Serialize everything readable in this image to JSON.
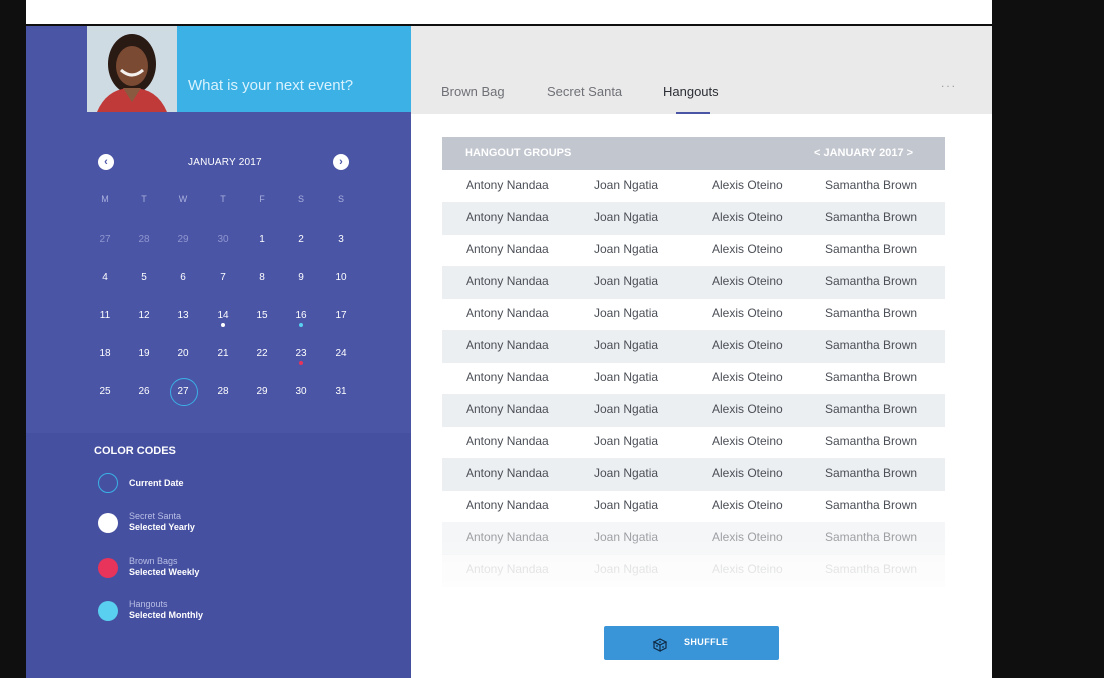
{
  "sidebar": {
    "prompt": "What is your next event?",
    "calendar": {
      "month": "JANUARY 2017",
      "prev_icon": "chevron-left-circle-icon",
      "next_icon": "chevron-right-circle-icon",
      "weekdays": [
        "M",
        "T",
        "W",
        "T",
        "F",
        "S",
        "S"
      ],
      "weeks": [
        [
          "27",
          "28",
          "29",
          "30",
          "1",
          "2",
          "3"
        ],
        [
          "4",
          "5",
          "6",
          "7",
          "8",
          "9",
          "10"
        ],
        [
          "11",
          "12",
          "13",
          "14",
          "15",
          "16",
          "17"
        ],
        [
          "18",
          "19",
          "20",
          "21",
          "22",
          "23",
          "24"
        ],
        [
          "25",
          "26",
          "27",
          "28",
          "29",
          "30",
          "31"
        ]
      ],
      "selected_day": "27"
    },
    "color_codes": {
      "title": "COLOR CODES",
      "items": [
        {
          "small": "",
          "strong": "Current Date",
          "color": "#3bb1e6",
          "style": "ring"
        },
        {
          "small": "Secret Santa",
          "strong": "Selected Yearly",
          "color": "#ffffff",
          "style": "fill"
        },
        {
          "small": "Brown Bags",
          "strong": "Selected Weekly",
          "color": "#e8335a",
          "style": "fill"
        },
        {
          "small": "Hangouts",
          "strong": "Selected Monthly",
          "color": "#5ad0f0",
          "style": "fill"
        }
      ]
    }
  },
  "tabs": [
    "Brown Bag",
    "Secret Santa",
    "Hangouts"
  ],
  "active_tab": "Hangouts",
  "more_label": "...",
  "table": {
    "title": "HANGOUT GROUPS",
    "month_nav": "<  JANUARY 2017  >",
    "rows": [
      [
        "Antony Nandaa",
        "Joan Ngatia",
        "Alexis Oteino",
        "Samantha Brown"
      ],
      [
        "Antony Nandaa",
        "Joan Ngatia",
        "Alexis Oteino",
        "Samantha Brown"
      ],
      [
        "Antony Nandaa",
        "Joan Ngatia",
        "Alexis Oteino",
        "Samantha Brown"
      ],
      [
        "Antony Nandaa",
        "Joan Ngatia",
        "Alexis Oteino",
        "Samantha Brown"
      ],
      [
        "Antony Nandaa",
        "Joan Ngatia",
        "Alexis Oteino",
        "Samantha Brown"
      ],
      [
        "Antony Nandaa",
        "Joan Ngatia",
        "Alexis Oteino",
        "Samantha Brown"
      ],
      [
        "Antony Nandaa",
        "Joan Ngatia",
        "Alexis Oteino",
        "Samantha Brown"
      ],
      [
        "Antony Nandaa",
        "Joan Ngatia",
        "Alexis Oteino",
        "Samantha Brown"
      ],
      [
        "Antony Nandaa",
        "Joan Ngatia",
        "Alexis Oteino",
        "Samantha Brown"
      ],
      [
        "Antony Nandaa",
        "Joan Ngatia",
        "Alexis Oteino",
        "Samantha Brown"
      ],
      [
        "Antony Nandaa",
        "Joan Ngatia",
        "Alexis Oteino",
        "Samantha Brown"
      ],
      [
        "Antony Nandaa",
        "Joan Ngatia",
        "Alexis Oteino",
        "Samantha Brown"
      ],
      [
        "Antony Nandaa",
        "Joan Ngatia",
        "Alexis Oteino",
        "Samantha Brown"
      ]
    ]
  },
  "shuffle": {
    "label": "SHUFFLE",
    "icon": "dice-icon",
    "color": "#3a95d8"
  },
  "colors": {
    "sidebar": "#4a55a6",
    "accent": "#3bb1e6",
    "header_gray": "#c2c6cf"
  }
}
